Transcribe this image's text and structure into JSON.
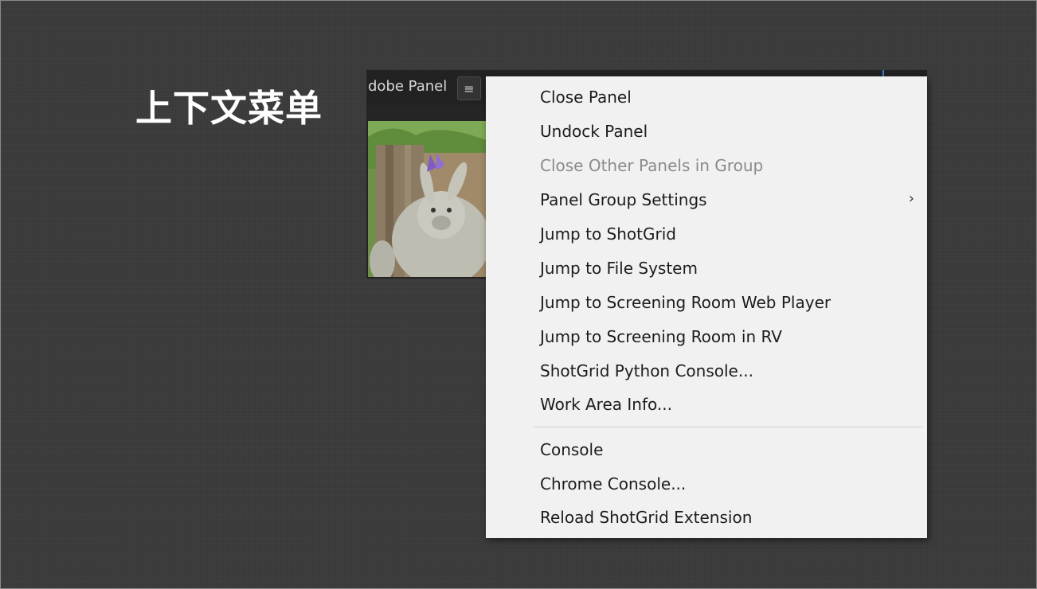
{
  "slide": {
    "title": "上下文菜单"
  },
  "panel": {
    "tab_label": "dobe Panel",
    "menu_button_glyph": "≡"
  },
  "context_menu": {
    "items": [
      {
        "label": "Close Panel",
        "enabled": true
      },
      {
        "label": "Undock Panel",
        "enabled": true
      },
      {
        "label": "Close Other Panels in Group",
        "enabled": false
      },
      {
        "label": "Panel Group Settings",
        "enabled": true,
        "submenu": true,
        "submenu_glyph": "›"
      },
      {
        "label": "Jump to ShotGrid",
        "enabled": true
      },
      {
        "label": "Jump to File System",
        "enabled": true
      },
      {
        "label": "Jump to Screening Room Web Player",
        "enabled": true
      },
      {
        "label": "Jump to Screening Room in RV",
        "enabled": true
      },
      {
        "label": "ShotGrid Python Console...",
        "enabled": true
      },
      {
        "label": "Work Area Info...",
        "enabled": true
      }
    ],
    "items_after_separator": [
      {
        "label": "Console",
        "enabled": true
      },
      {
        "label": "Chrome Console...",
        "enabled": true
      },
      {
        "label": "Reload ShotGrid Extension",
        "enabled": true
      }
    ]
  },
  "colors": {
    "background": "#3b3b3b",
    "menu_background": "#f1f1f1",
    "menu_text": "#1c1c1c",
    "menu_text_disabled": "#8a8a8a",
    "accent_blue": "#3f7fd1"
  }
}
